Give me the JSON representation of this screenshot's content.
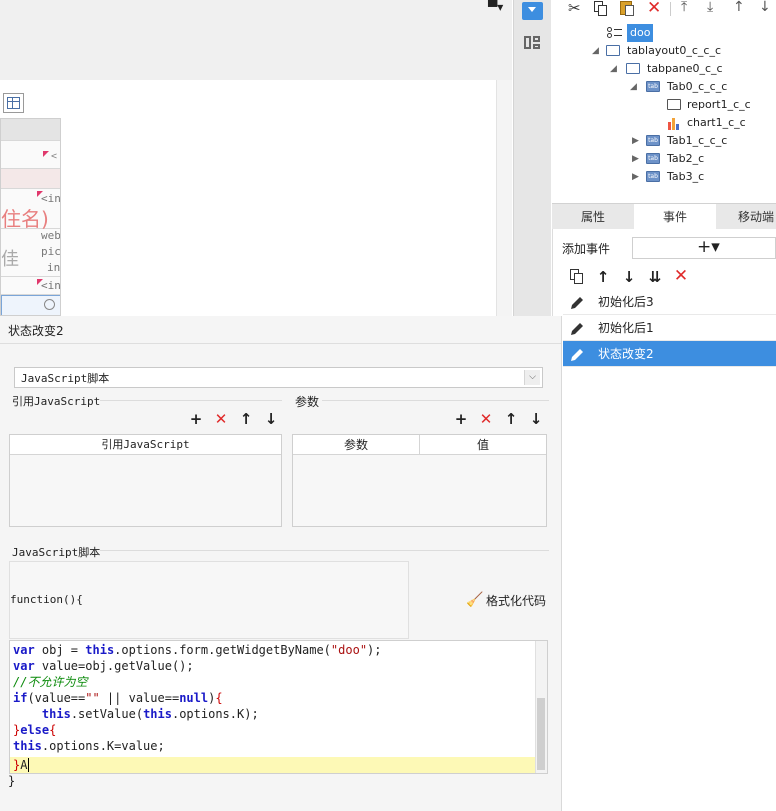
{
  "canvas": {
    "grid_text": [
      "住名)",
      "佳"
    ],
    "grid_snippets": [
      "<in",
      "web",
      "pic",
      "in",
      "<in"
    ]
  },
  "tree": {
    "nodes": [
      {
        "label": "doo",
        "selected": true
      },
      {
        "label": "tablayout0_c_c_c"
      },
      {
        "label": "tabpane0_c_c"
      },
      {
        "label": "Tab0_c_c_c"
      },
      {
        "label": "report1_c_c"
      },
      {
        "label": "chart1_c_c"
      },
      {
        "label": "Tab1_c_c_c"
      },
      {
        "label": "Tab2_c"
      },
      {
        "label": "Tab3_c"
      }
    ]
  },
  "tabs": [
    {
      "label": "属性"
    },
    {
      "label": "事件",
      "active": true
    },
    {
      "label": "移动端"
    }
  ],
  "events": {
    "add_label": "添加事件",
    "add_button": "+▾",
    "items": [
      {
        "label": "初始化后3"
      },
      {
        "label": "初始化后1"
      },
      {
        "label": "状态改变2",
        "selected": true
      }
    ]
  },
  "editor": {
    "title": "状态改变2",
    "type_value": "JavaScript脚本",
    "ref_js_label": "引用JavaScript",
    "params_label": "参数",
    "ref_js_col": "引用JavaScript",
    "param_col": "参数",
    "value_col": "值",
    "script_label": "JavaScript脚本",
    "fn_header": "function(){",
    "format_btn": "格式化代码",
    "closing": "}",
    "code": [
      "var obj = this.options.form.getWidgetByName(\"doo\");",
      "var value=obj.getValue();",
      "//不允许为空",
      "if(value==\"\" || value==null){",
      "    this.setValue(this.options.K);",
      "}else{",
      "this.options.K=value;",
      "}A"
    ]
  },
  "colors": {
    "accent": "#3d8ee0",
    "delete": "#e02a2a",
    "keyword": "#1a1ac8",
    "string": "#a11111",
    "comment": "#0a8a0a",
    "highlight": "#fdf9b6"
  }
}
